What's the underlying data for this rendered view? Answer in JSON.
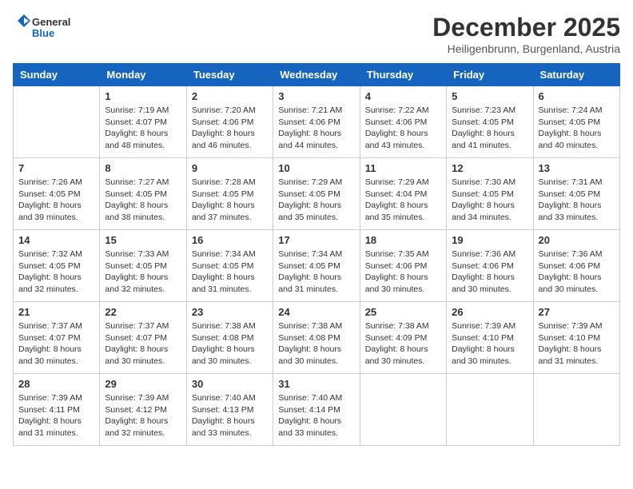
{
  "header": {
    "logo_line1": "General",
    "logo_line2": "Blue",
    "month_title": "December 2025",
    "location": "Heiligenbrunn, Burgenland, Austria"
  },
  "weekdays": [
    "Sunday",
    "Monday",
    "Tuesday",
    "Wednesday",
    "Thursday",
    "Friday",
    "Saturday"
  ],
  "weeks": [
    [
      {
        "day": "",
        "info": ""
      },
      {
        "day": "1",
        "info": "Sunrise: 7:19 AM\nSunset: 4:07 PM\nDaylight: 8 hours\nand 48 minutes."
      },
      {
        "day": "2",
        "info": "Sunrise: 7:20 AM\nSunset: 4:06 PM\nDaylight: 8 hours\nand 46 minutes."
      },
      {
        "day": "3",
        "info": "Sunrise: 7:21 AM\nSunset: 4:06 PM\nDaylight: 8 hours\nand 44 minutes."
      },
      {
        "day": "4",
        "info": "Sunrise: 7:22 AM\nSunset: 4:06 PM\nDaylight: 8 hours\nand 43 minutes."
      },
      {
        "day": "5",
        "info": "Sunrise: 7:23 AM\nSunset: 4:05 PM\nDaylight: 8 hours\nand 41 minutes."
      },
      {
        "day": "6",
        "info": "Sunrise: 7:24 AM\nSunset: 4:05 PM\nDaylight: 8 hours\nand 40 minutes."
      }
    ],
    [
      {
        "day": "7",
        "info": "Sunrise: 7:26 AM\nSunset: 4:05 PM\nDaylight: 8 hours\nand 39 minutes."
      },
      {
        "day": "8",
        "info": "Sunrise: 7:27 AM\nSunset: 4:05 PM\nDaylight: 8 hours\nand 38 minutes."
      },
      {
        "day": "9",
        "info": "Sunrise: 7:28 AM\nSunset: 4:05 PM\nDaylight: 8 hours\nand 37 minutes."
      },
      {
        "day": "10",
        "info": "Sunrise: 7:29 AM\nSunset: 4:05 PM\nDaylight: 8 hours\nand 35 minutes."
      },
      {
        "day": "11",
        "info": "Sunrise: 7:29 AM\nSunset: 4:04 PM\nDaylight: 8 hours\nand 35 minutes."
      },
      {
        "day": "12",
        "info": "Sunrise: 7:30 AM\nSunset: 4:05 PM\nDaylight: 8 hours\nand 34 minutes."
      },
      {
        "day": "13",
        "info": "Sunrise: 7:31 AM\nSunset: 4:05 PM\nDaylight: 8 hours\nand 33 minutes."
      }
    ],
    [
      {
        "day": "14",
        "info": "Sunrise: 7:32 AM\nSunset: 4:05 PM\nDaylight: 8 hours\nand 32 minutes."
      },
      {
        "day": "15",
        "info": "Sunrise: 7:33 AM\nSunset: 4:05 PM\nDaylight: 8 hours\nand 32 minutes."
      },
      {
        "day": "16",
        "info": "Sunrise: 7:34 AM\nSunset: 4:05 PM\nDaylight: 8 hours\nand 31 minutes."
      },
      {
        "day": "17",
        "info": "Sunrise: 7:34 AM\nSunset: 4:05 PM\nDaylight: 8 hours\nand 31 minutes."
      },
      {
        "day": "18",
        "info": "Sunrise: 7:35 AM\nSunset: 4:06 PM\nDaylight: 8 hours\nand 30 minutes."
      },
      {
        "day": "19",
        "info": "Sunrise: 7:36 AM\nSunset: 4:06 PM\nDaylight: 8 hours\nand 30 minutes."
      },
      {
        "day": "20",
        "info": "Sunrise: 7:36 AM\nSunset: 4:06 PM\nDaylight: 8 hours\nand 30 minutes."
      }
    ],
    [
      {
        "day": "21",
        "info": "Sunrise: 7:37 AM\nSunset: 4:07 PM\nDaylight: 8 hours\nand 30 minutes."
      },
      {
        "day": "22",
        "info": "Sunrise: 7:37 AM\nSunset: 4:07 PM\nDaylight: 8 hours\nand 30 minutes."
      },
      {
        "day": "23",
        "info": "Sunrise: 7:38 AM\nSunset: 4:08 PM\nDaylight: 8 hours\nand 30 minutes."
      },
      {
        "day": "24",
        "info": "Sunrise: 7:38 AM\nSunset: 4:08 PM\nDaylight: 8 hours\nand 30 minutes."
      },
      {
        "day": "25",
        "info": "Sunrise: 7:38 AM\nSunset: 4:09 PM\nDaylight: 8 hours\nand 30 minutes."
      },
      {
        "day": "26",
        "info": "Sunrise: 7:39 AM\nSunset: 4:10 PM\nDaylight: 8 hours\nand 30 minutes."
      },
      {
        "day": "27",
        "info": "Sunrise: 7:39 AM\nSunset: 4:10 PM\nDaylight: 8 hours\nand 31 minutes."
      }
    ],
    [
      {
        "day": "28",
        "info": "Sunrise: 7:39 AM\nSunset: 4:11 PM\nDaylight: 8 hours\nand 31 minutes."
      },
      {
        "day": "29",
        "info": "Sunrise: 7:39 AM\nSunset: 4:12 PM\nDaylight: 8 hours\nand 32 minutes."
      },
      {
        "day": "30",
        "info": "Sunrise: 7:40 AM\nSunset: 4:13 PM\nDaylight: 8 hours\nand 33 minutes."
      },
      {
        "day": "31",
        "info": "Sunrise: 7:40 AM\nSunset: 4:14 PM\nDaylight: 8 hours\nand 33 minutes."
      },
      {
        "day": "",
        "info": ""
      },
      {
        "day": "",
        "info": ""
      },
      {
        "day": "",
        "info": ""
      }
    ]
  ]
}
